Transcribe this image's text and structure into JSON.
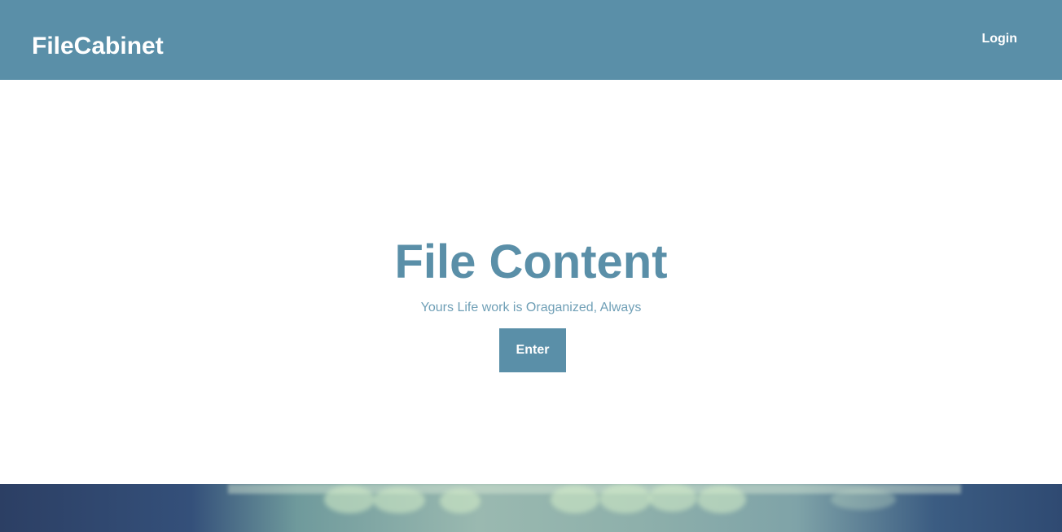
{
  "navbar": {
    "brand": "FileCabinet",
    "login_label": "Login",
    "background_color": "#5a8fa8"
  },
  "hero": {
    "title": "File Content",
    "subtitle": "Yours Life work is Oraganized, Always",
    "enter_label": "Enter",
    "accent_color": "#5a8fa8"
  },
  "footer_image": {
    "description_icon": "blurred-bokeh-photo"
  }
}
